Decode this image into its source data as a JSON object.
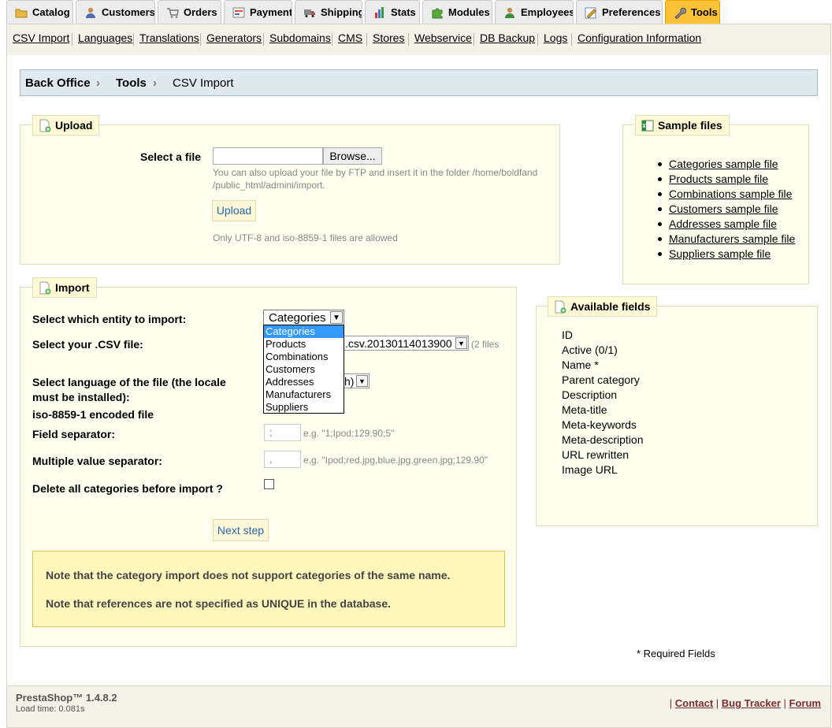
{
  "tabs": [
    {
      "label": "Catalog",
      "icon": "folder-icon"
    },
    {
      "label": "Customers",
      "icon": "customers-icon"
    },
    {
      "label": "Orders",
      "icon": "orders-icon"
    },
    {
      "label": "Payment",
      "icon": "payment-icon"
    },
    {
      "label": "Shipping",
      "icon": "truck-icon"
    },
    {
      "label": "Stats",
      "icon": "chart-icon"
    },
    {
      "label": "Modules",
      "icon": "puzzle-icon"
    },
    {
      "label": "Employees",
      "icon": "employees-icon"
    },
    {
      "label": "Preferences",
      "icon": "preferences-icon"
    },
    {
      "label": "Tools",
      "icon": "wrench-icon",
      "active": true
    }
  ],
  "submenu": [
    "CSV Import",
    "Languages",
    "Translations",
    "Generators",
    "Subdomains",
    "CMS",
    "Stores",
    "Webservice",
    "DB Backup",
    "Logs",
    "Configuration Information"
  ],
  "breadcrumb": {
    "root": "Back Office",
    "section": "Tools",
    "current": "CSV Import"
  },
  "upload": {
    "legend": "Upload",
    "select_label": "Select a file",
    "browse_label": "Browse...",
    "hint_line1": "You can also upload your file by FTP and insert it in the folder /home/boldfand",
    "hint_line2": "/public_html/admini/import.",
    "button": "Upload",
    "encoding_note": "Only UTF-8 and iso-8859-1 files are allowed"
  },
  "import": {
    "legend": "Import",
    "entity_label": "Select which entity to import:",
    "entity_value": "Categories",
    "entity_options": [
      "Categories",
      "Products",
      "Combinations",
      "Customers",
      "Addresses",
      "Manufacturers",
      "Suppliers"
    ],
    "csv_label": "Select your .CSV file:",
    "csv_value": ".csv.20130114013900",
    "csv_count": "(2 files",
    "language_label_line1": "Select language of the file (the locale",
    "language_label_line2": "must be installed):",
    "language_value": "h)",
    "encoding_label": "iso-8859-1 encoded file",
    "field_sep_label": "Field separator:",
    "field_sep_value": ";",
    "field_sep_example": "e.g. \"1;Ipod;129.90;5\"",
    "multi_sep_label": "Multiple value separator:",
    "multi_sep_value": ",",
    "multi_sep_example": "e.g. \"Ipod;red.jpg,blue.jpg,green.jpg;129.90\"",
    "delete_label": "Delete all categories before import ?",
    "next_button": "Next step",
    "note1": "Note that the category import does not support categories of the same name.",
    "note2": "Note that references are not specified as UNIQUE in the database."
  },
  "sample_files": {
    "legend": "Sample files",
    "items": [
      "Categories sample file",
      "Products sample file",
      "Combinations sample file",
      "Customers sample file",
      "Addresses sample file",
      "Manufacturers sample file",
      "Suppliers sample file"
    ]
  },
  "available_fields": {
    "legend": "Available fields",
    "items": [
      "ID",
      "Active (0/1)",
      "Name *",
      "Parent category",
      "Description",
      "Meta-title",
      "Meta-keywords",
      "Meta-description",
      "URL rewritten",
      "Image URL"
    ]
  },
  "required_note": "* Required Fields",
  "footer": {
    "brand": "PrestaShop™ 1.4.8.2",
    "load_time": "Load time: 0.081s",
    "links": [
      "Contact",
      "Bug Tracker",
      "Forum"
    ]
  }
}
